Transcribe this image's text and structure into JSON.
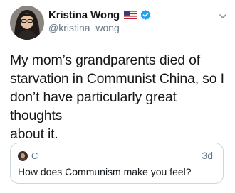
{
  "author": {
    "display_name": "Kristina Wong",
    "handle": "@kristina_wong",
    "flag_icon": "us-flag-icon",
    "verified_icon": "verified-badge-icon",
    "verified_color": "#1da1f2"
  },
  "tweet": {
    "text": "My mom’s grandparents died of\nstarvation in Communist China, so I\ndon’t have particularly great thoughts\nabout it."
  },
  "quoted_tweet": {
    "name": "C",
    "time": "3d",
    "text": "How does Communism make you feel?"
  },
  "colors": {
    "text_primary": "#14171a",
    "text_secondary": "#657786",
    "border": "#ccd6dd"
  }
}
